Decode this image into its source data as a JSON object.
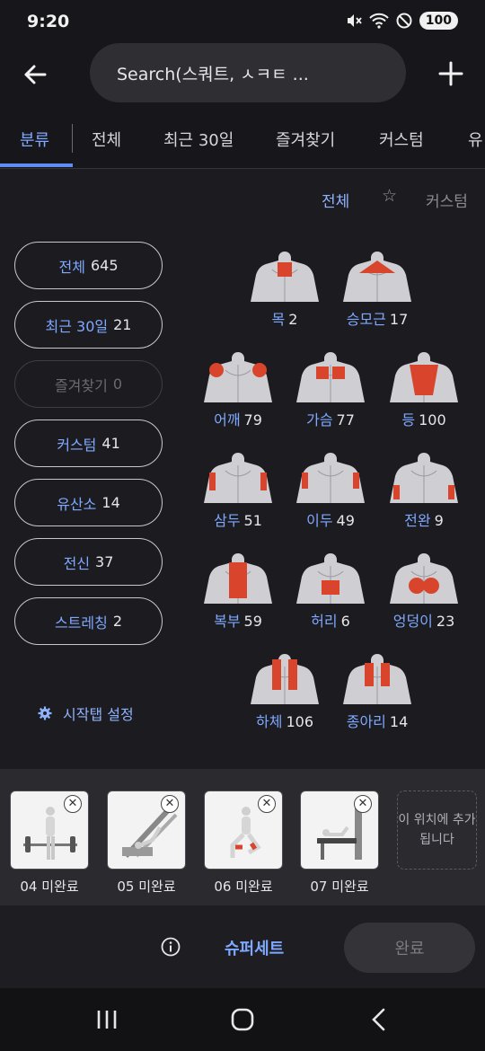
{
  "status_bar": {
    "time": "9:20",
    "battery": "100",
    "icons": [
      "mute-icon",
      "wifi-icon",
      "do-not-disturb-icon",
      "battery-icon"
    ]
  },
  "top_bar": {
    "search_placeholder": "Search(스쿼트, ㅅㅋㅌ ...",
    "icons": [
      "back-arrow-icon",
      "plus-icon"
    ]
  },
  "tabs": [
    "분류",
    "전체",
    "최근 30일",
    "즐겨찾기",
    "커스텀",
    "유"
  ],
  "filter_row": {
    "all": "전체",
    "star": "☆",
    "custom": "커스텀"
  },
  "categories": [
    {
      "label": "전체",
      "count": "645"
    },
    {
      "label": "최근 30일",
      "count": "21"
    },
    {
      "label": "즐겨찾기",
      "count": "0"
    },
    {
      "label": "커스텀",
      "count": "41"
    },
    {
      "label": "유산소",
      "count": "14"
    },
    {
      "label": "전신",
      "count": "37"
    },
    {
      "label": "스트레칭",
      "count": "2"
    }
  ],
  "start_tab": {
    "label": "시작탭 설정"
  },
  "muscles": [
    {
      "name": "목",
      "count": "2"
    },
    {
      "name": "승모근",
      "count": "17"
    },
    {
      "name": "어깨",
      "count": "79"
    },
    {
      "name": "가슴",
      "count": "77"
    },
    {
      "name": "등",
      "count": "100"
    },
    {
      "name": "삼두",
      "count": "51"
    },
    {
      "name": "이두",
      "count": "49"
    },
    {
      "name": "전완",
      "count": "9"
    },
    {
      "name": "복부",
      "count": "59"
    },
    {
      "name": "허리",
      "count": "6"
    },
    {
      "name": "엉덩이",
      "count": "23"
    },
    {
      "name": "하체",
      "count": "106"
    },
    {
      "name": "종아리",
      "count": "14"
    }
  ],
  "tray": {
    "items": [
      {
        "label": "04 미완료"
      },
      {
        "label": "05 미완료"
      },
      {
        "label": "06 미완료"
      },
      {
        "label": "07 미완료"
      }
    ],
    "add_slot": "이 위치에 추가됩니다"
  },
  "action_bar": {
    "superset": "슈퍼세트",
    "done": "완료"
  },
  "colors": {
    "accent": "#7fa8ff",
    "muscle_highlight": "#d8452c",
    "background": "#1c1c20"
  }
}
